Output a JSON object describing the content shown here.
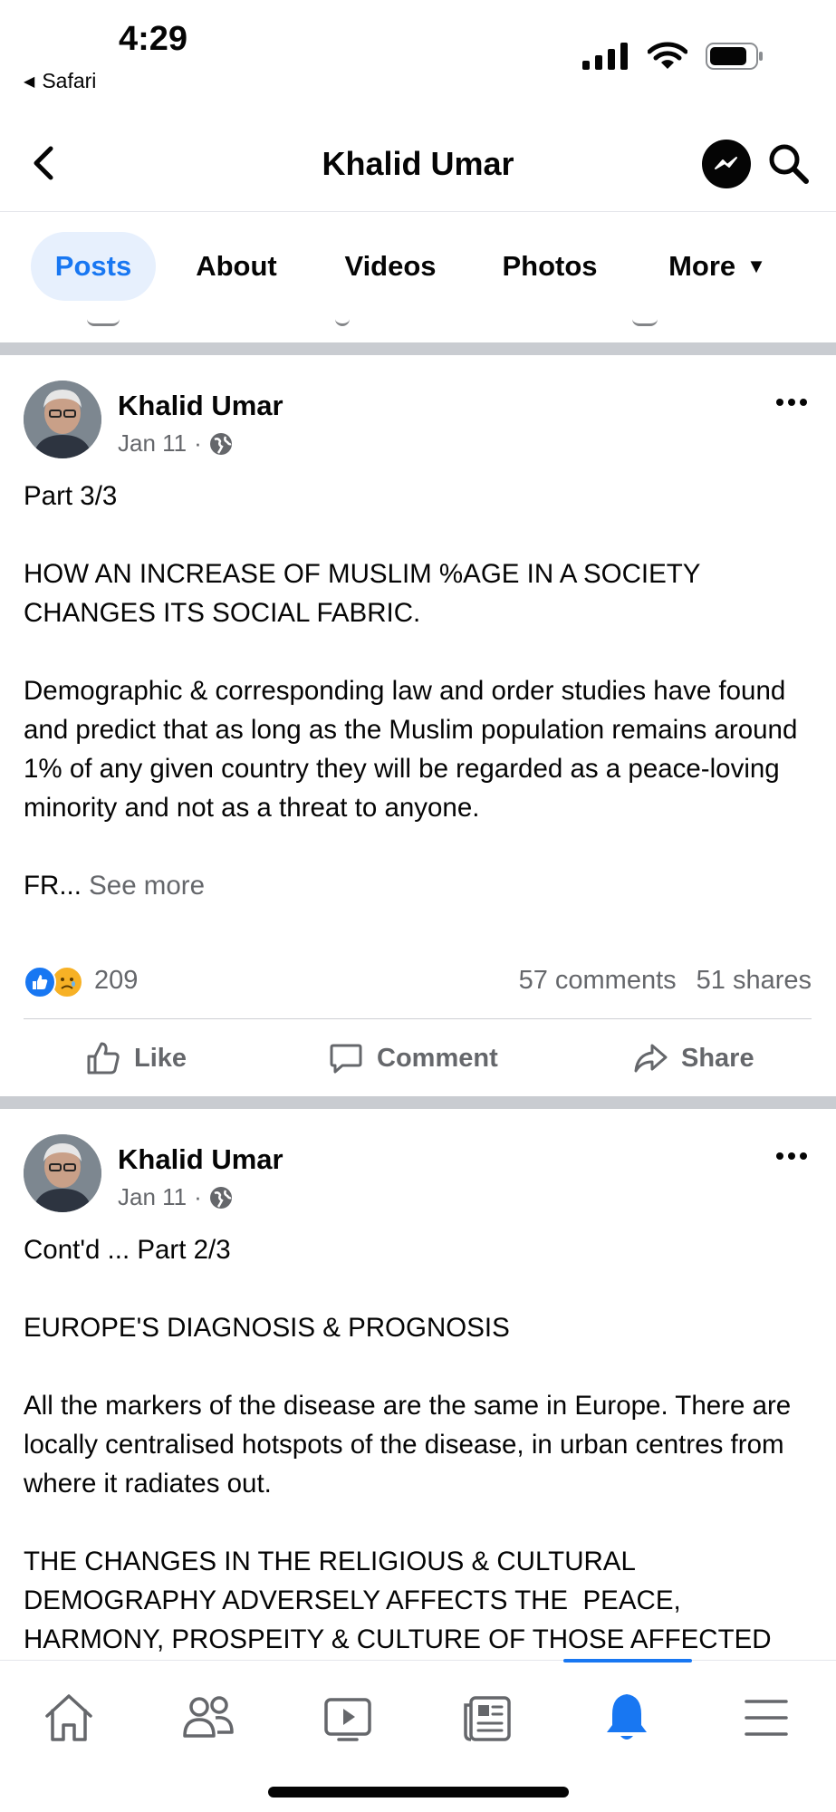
{
  "status_bar": {
    "time": "4:29",
    "back_app": "Safari"
  },
  "header": {
    "title": "Khalid Umar"
  },
  "tabs": [
    {
      "label": "Posts",
      "active": true
    },
    {
      "label": "About",
      "active": false
    },
    {
      "label": "Videos",
      "active": false
    },
    {
      "label": "Photos",
      "active": false
    },
    {
      "label": "More",
      "active": false
    }
  ],
  "posts": [
    {
      "author": "Khalid Umar",
      "date": "Jan 11",
      "audience_icon": "globe-icon",
      "paragraphs": [
        "Part 3/3",
        "HOW AN INCREASE OF MUSLIM %AGE IN A SOCIETY CHANGES ITS SOCIAL FABRIC.",
        "Demographic & corresponding law and order studies have found and predict that as long as the Muslim population remains around 1% of any given country they will be regarded as a peace-loving minority and not as a threat to anyone."
      ],
      "truncated_text": "FR...",
      "see_more": "See more",
      "reaction_count": "209",
      "comments": "57 comments",
      "shares": "51 shares",
      "actions": {
        "like": "Like",
        "comment": "Comment",
        "share": "Share"
      }
    },
    {
      "author": "Khalid Umar",
      "date": "Jan 11",
      "audience_icon": "globe-icon",
      "paragraphs": [
        "Cont'd ... Part 2/3",
        "EUROPE'S DIAGNOSIS & PROGNOSIS",
        "All the markers of the disease are the same in Europe. There are locally centralised hotspots of the disease, in urban centres from where it radiates out.",
        "THE CHANGES IN THE RELIGIOUS & CULTURAL DEMOGRAPHY ADVERSELY AFFECTS THE  PEACE, HARMONY, PROSPEITY & CULTURE OF THOSE AFFECTED"
      ]
    }
  ],
  "colors": {
    "accent": "#1877f2",
    "separator": "#c9ccd1",
    "muted": "#65676b"
  }
}
